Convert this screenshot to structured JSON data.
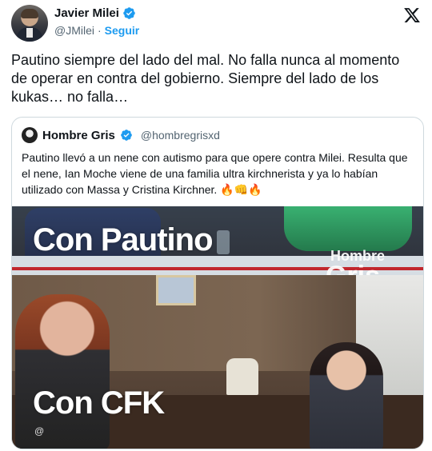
{
  "author": {
    "display_name": "Javier Milei",
    "handle": "@JMilei",
    "separator": "·",
    "follow_label": "Seguir",
    "verified": true
  },
  "tweet": {
    "text": "Pautino siempre del lado del mal. No falla nunca al momento de operar en contra del gobierno. Siempre del lado de los kukas… no falla…"
  },
  "quoted": {
    "display_name": "Hombre Gris",
    "handle": "@hombregrisxd",
    "verified": true,
    "text": "Pautino llevó a un nene con autismo para  que opere contra Milei. Resulta que el nene, Ian Moche viene de una familia ultra kirchnerista y ya lo habían utilizado con Massa y Cristina Kirchner. 🔥👊🔥",
    "media": {
      "top_caption": "Con Pautino",
      "bottom_caption": "Con CFK",
      "watermark_line1": "Hombre",
      "watermark_line2": "Gris",
      "corner_mark": "@"
    }
  },
  "colors": {
    "accent": "#1d9bf0",
    "text": "#0f1419",
    "muted": "#536471",
    "border": "#cfd9de"
  },
  "icons": [
    "verified-badge-icon",
    "x-logo-icon"
  ]
}
